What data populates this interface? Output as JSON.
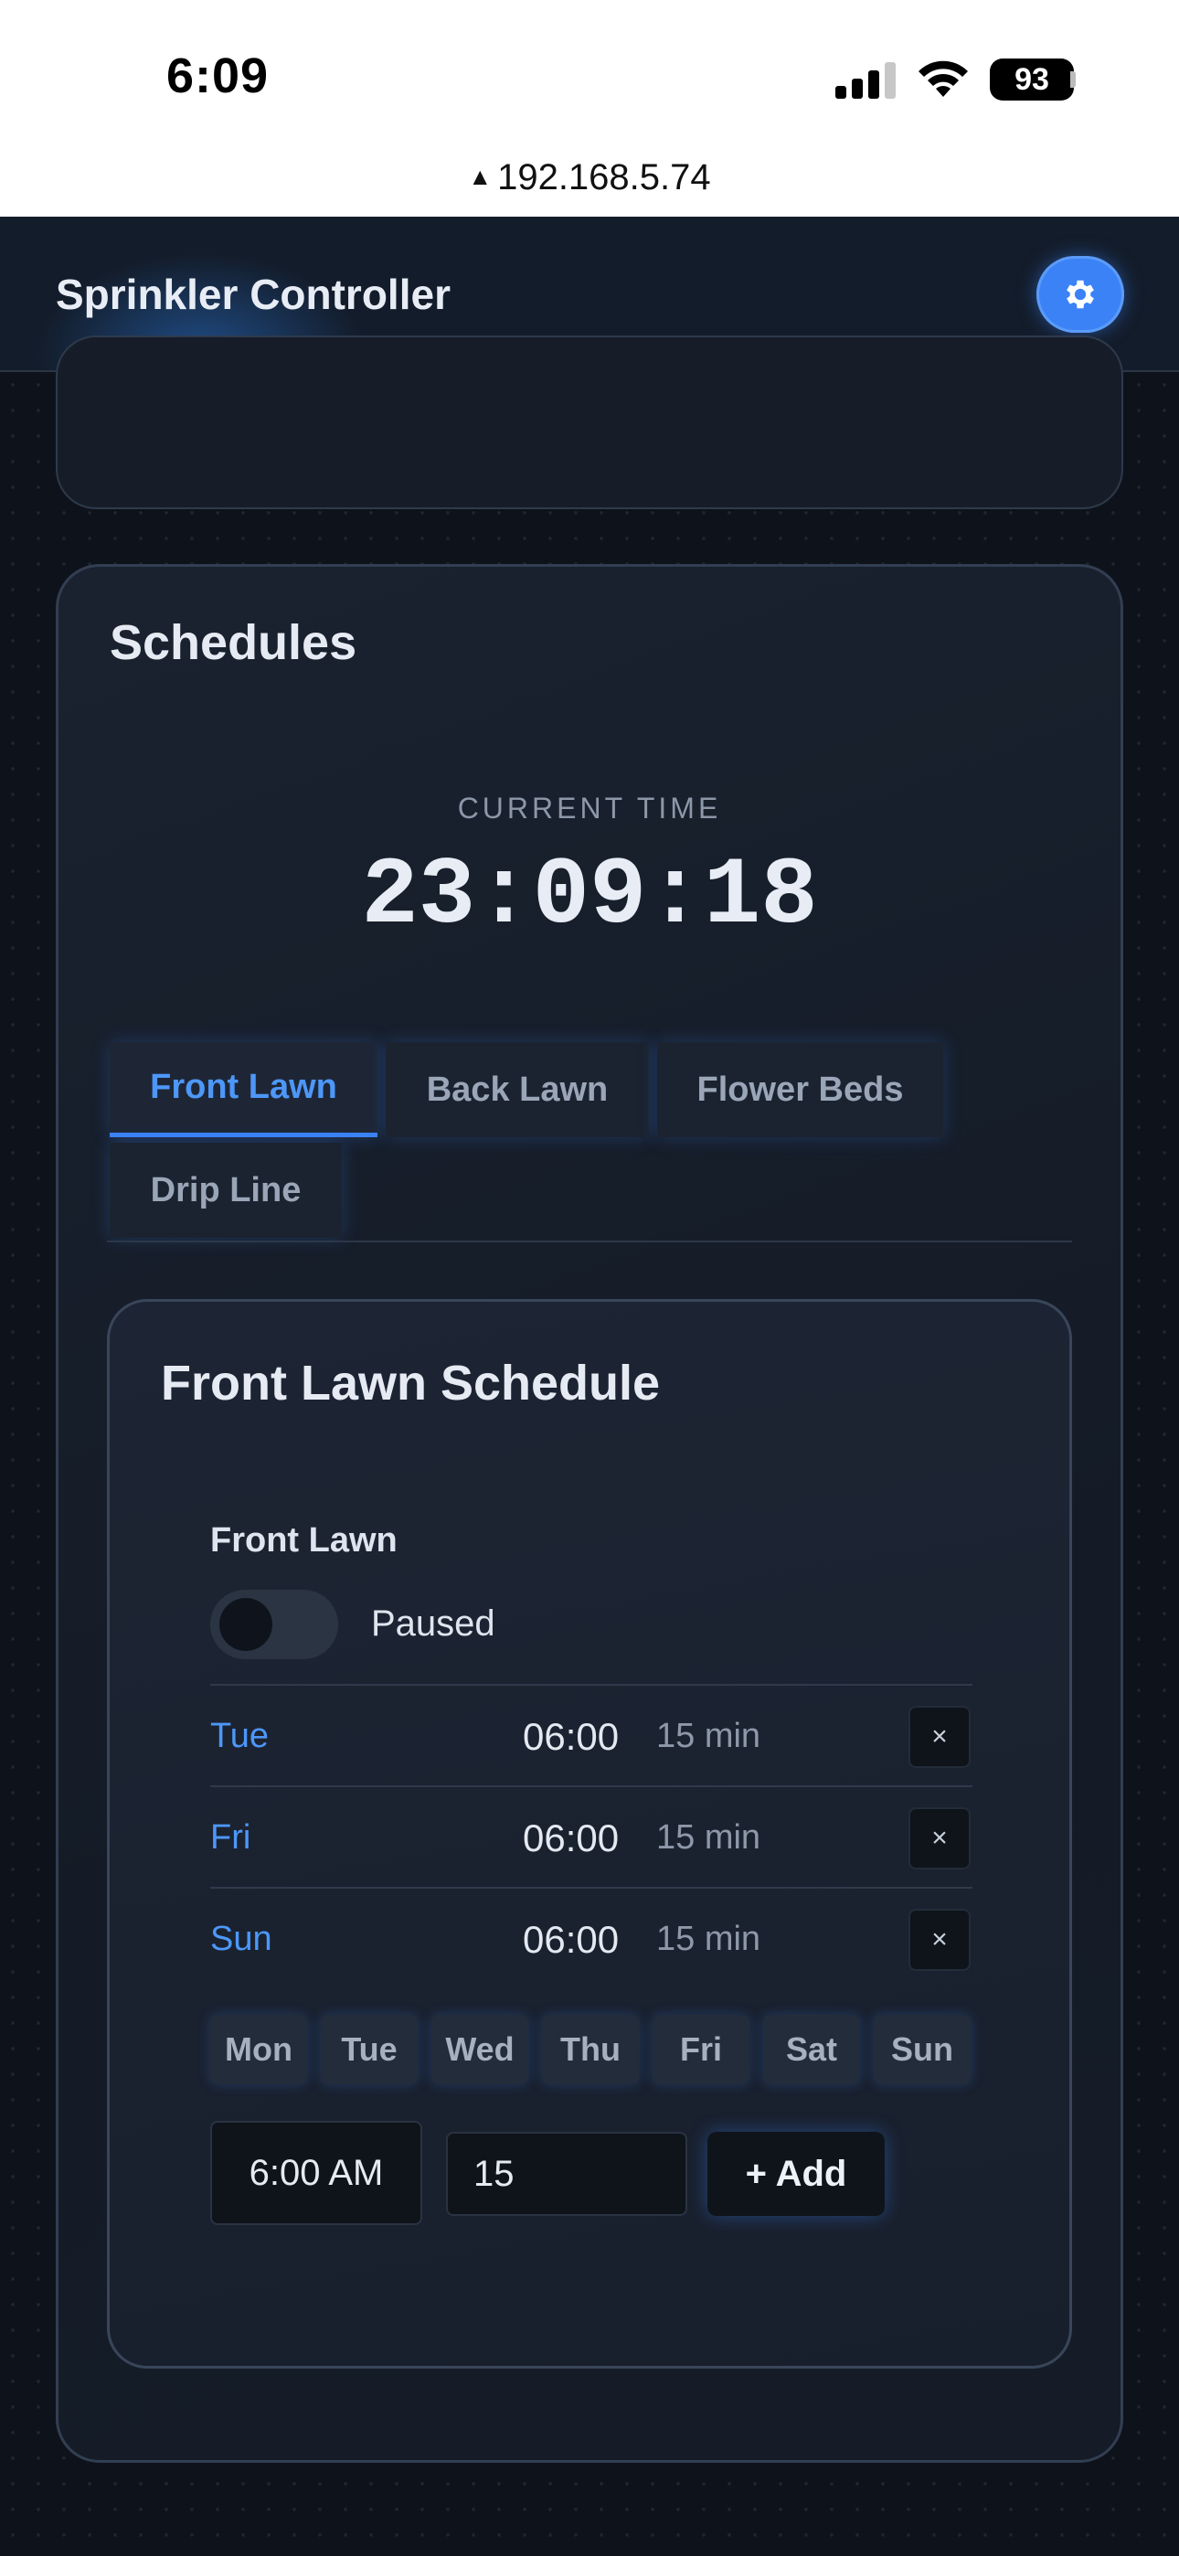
{
  "status_bar": {
    "time": "6:09",
    "battery": "93",
    "url": "192.168.5.74",
    "url_warning": "▲"
  },
  "header": {
    "title": "Sprinkler Controller",
    "settings_icon": "gear-icon"
  },
  "schedules": {
    "title": "Schedules",
    "current_time_label": "CURRENT TIME",
    "current_time": "23:09:18",
    "tabs": [
      {
        "label": "Front Lawn",
        "active": true
      },
      {
        "label": "Back Lawn",
        "active": false
      },
      {
        "label": "Flower Beds",
        "active": false
      },
      {
        "label": "Drip Line",
        "active": false
      }
    ],
    "panel": {
      "title": "Front Lawn Schedule",
      "zone_name": "Front Lawn",
      "toggle_state": "Paused",
      "entries": [
        {
          "day": "Tue",
          "time": "06:00",
          "duration": "15 min",
          "delete": "×"
        },
        {
          "day": "Fri",
          "time": "06:00",
          "duration": "15 min",
          "delete": "×"
        },
        {
          "day": "Sun",
          "time": "06:00",
          "duration": "15 min",
          "delete": "×"
        }
      ],
      "days": [
        "Mon",
        "Tue",
        "Wed",
        "Thu",
        "Fri",
        "Sat",
        "Sun"
      ],
      "time_input": "6:00 AM",
      "duration_input": "15",
      "add_label": "+ Add"
    }
  },
  "colors": {
    "accent": "#3b82f6",
    "background": "#0e131b",
    "card": "#1a2230"
  }
}
